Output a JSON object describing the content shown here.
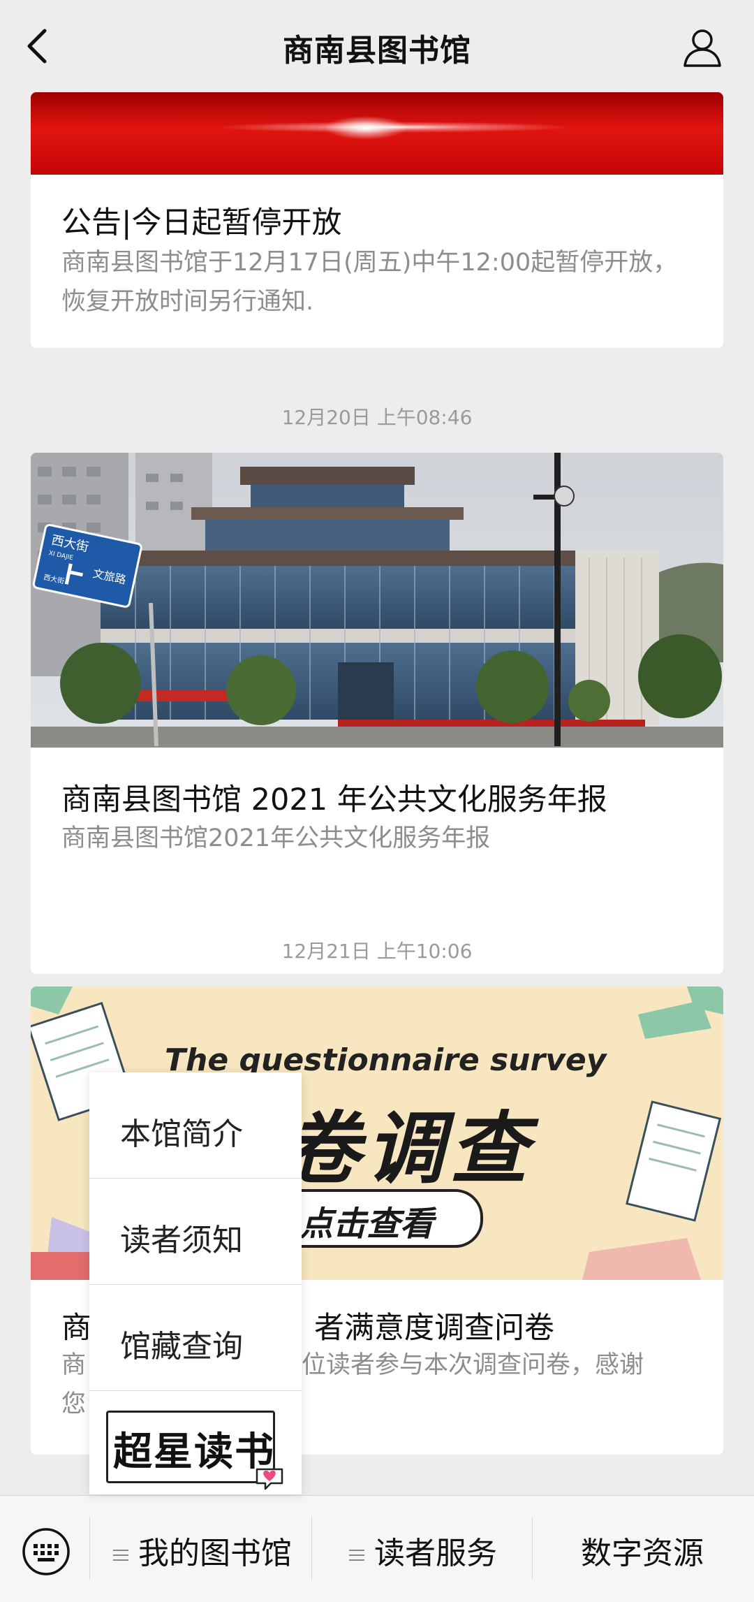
{
  "header": {
    "title": "商南县图书馆"
  },
  "messages": [
    {
      "title": "公告|今日起暂停开放",
      "description": "商南县图书馆于12月17日(周五)中午12:00起暂停开放，恢复开放时间另行通知."
    },
    {
      "timestamp": "12月20日 上午08:46",
      "title": "商南县图书馆 2021 年公共文化服务年报",
      "description": "商南县图书馆2021年公共文化服务年报",
      "sign_text": {
        "street_cn": "西大街",
        "street_en": "XI DAJIE",
        "road_cn": "文旅路",
        "sub_cn": "西大街"
      }
    },
    {
      "timestamp": "12月21日 上午10:06",
      "title_visible": "商",
      "title_visible_rest": "者满意度调查问卷",
      "description_visible": "商",
      "description_visible_rest": "位读者参与本次调查问卷，感谢",
      "description_line2_visible": "您",
      "banner": {
        "en": "The questionnaire survey",
        "cn": "卷调查",
        "button": "点击查看"
      }
    }
  ],
  "popup_menu": {
    "items": [
      {
        "label": "本馆简介"
      },
      {
        "label": "读者须知"
      },
      {
        "label": "馆藏查询"
      }
    ],
    "logo_text": "超星读书"
  },
  "bottom_bar": {
    "keyboard_icon": "keyboard-icon",
    "tabs": [
      {
        "label": "我的图书馆"
      },
      {
        "label": "读者服务"
      },
      {
        "label": "数字资源"
      }
    ]
  },
  "colors": {
    "banner_red": "#d40d0d",
    "survey_bg": "#f7e6bf"
  }
}
